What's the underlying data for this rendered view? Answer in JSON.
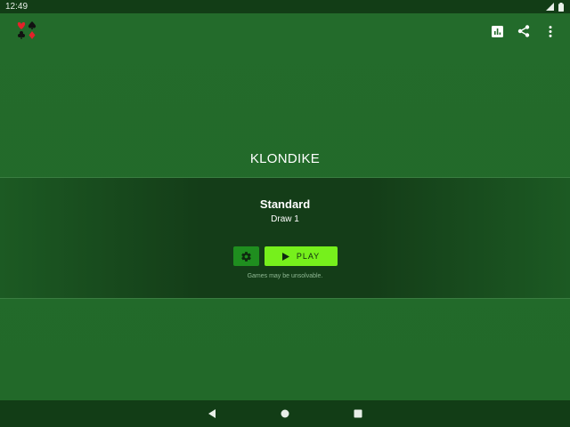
{
  "status_bar": {
    "time": "12:49",
    "icons": [
      "signal-icon",
      "battery-icon"
    ]
  },
  "header": {
    "app_icon": "card-suits-icon",
    "actions": [
      "statistics-icon",
      "share-icon",
      "more-vert-icon"
    ]
  },
  "game": {
    "title": "KLONDIKE",
    "variant": "Standard",
    "variant_detail": "Draw 1",
    "play_label": "PLAY",
    "settings_icon": "gear-icon",
    "note": "Games may be unsolvable."
  },
  "nav": {
    "icons": [
      "back-icon",
      "home-icon",
      "recents-icon"
    ]
  },
  "colors": {
    "table_green": "#236a2a",
    "bar_dark": "#123d16",
    "play_accent": "#76f01c",
    "settings_accent": "#1f8e1f"
  }
}
